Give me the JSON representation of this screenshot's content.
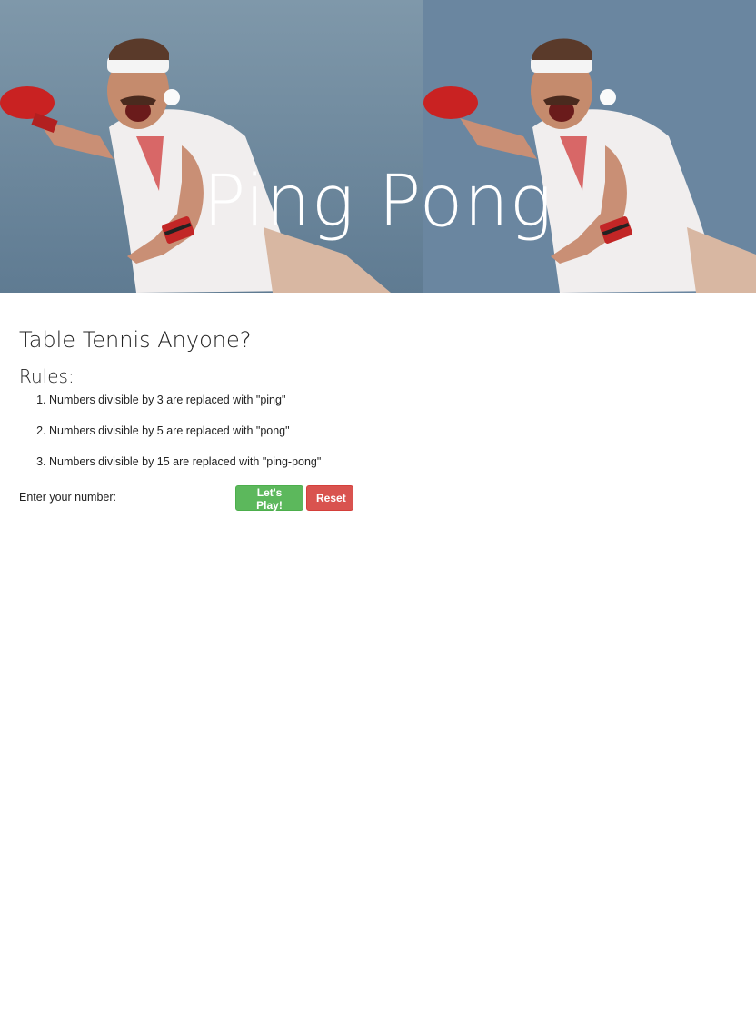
{
  "hero": {
    "title": "Ping Pong",
    "image_desc": "man in white headband and red paddle lunging for a ping pong ball"
  },
  "main": {
    "subtitle": "Table Tennis Anyone?",
    "rules_heading": "Rules:",
    "rules": [
      "Numbers divisible by 3 are replaced with \"ping\"",
      "Numbers divisible by 5 are replaced with \"pong\"",
      "Numbers divisible by 15 are replaced with \"ping-pong\""
    ]
  },
  "form": {
    "label": "Enter your number:",
    "input_value": "",
    "play_label": "Let's Play!",
    "reset_label": "Reset"
  },
  "colors": {
    "success": "#5cb85c",
    "danger": "#d9534f",
    "hero_bg": "#7089a0"
  }
}
